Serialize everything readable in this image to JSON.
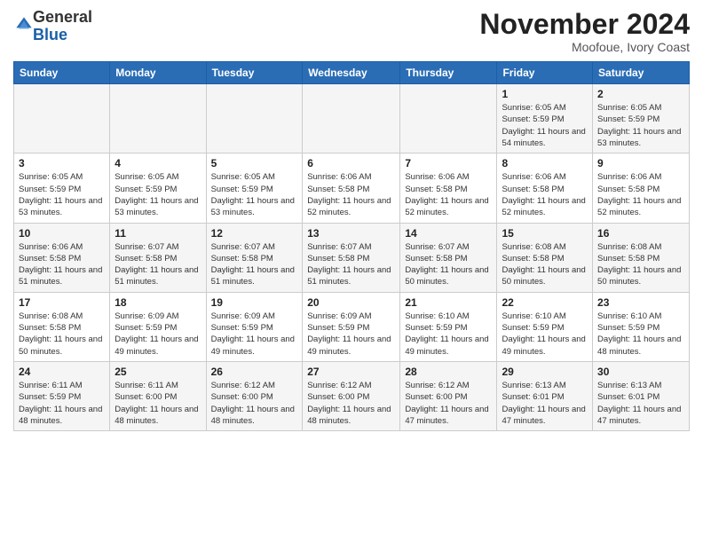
{
  "logo": {
    "general": "General",
    "blue": "Blue"
  },
  "header": {
    "month": "November 2024",
    "location": "Moofoue, Ivory Coast"
  },
  "weekdays": [
    "Sunday",
    "Monday",
    "Tuesday",
    "Wednesday",
    "Thursday",
    "Friday",
    "Saturday"
  ],
  "weeks": [
    [
      {
        "day": "",
        "info": ""
      },
      {
        "day": "",
        "info": ""
      },
      {
        "day": "",
        "info": ""
      },
      {
        "day": "",
        "info": ""
      },
      {
        "day": "",
        "info": ""
      },
      {
        "day": "1",
        "info": "Sunrise: 6:05 AM\nSunset: 5:59 PM\nDaylight: 11 hours and 54 minutes."
      },
      {
        "day": "2",
        "info": "Sunrise: 6:05 AM\nSunset: 5:59 PM\nDaylight: 11 hours and 53 minutes."
      }
    ],
    [
      {
        "day": "3",
        "info": "Sunrise: 6:05 AM\nSunset: 5:59 PM\nDaylight: 11 hours and 53 minutes."
      },
      {
        "day": "4",
        "info": "Sunrise: 6:05 AM\nSunset: 5:59 PM\nDaylight: 11 hours and 53 minutes."
      },
      {
        "day": "5",
        "info": "Sunrise: 6:05 AM\nSunset: 5:59 PM\nDaylight: 11 hours and 53 minutes."
      },
      {
        "day": "6",
        "info": "Sunrise: 6:06 AM\nSunset: 5:58 PM\nDaylight: 11 hours and 52 minutes."
      },
      {
        "day": "7",
        "info": "Sunrise: 6:06 AM\nSunset: 5:58 PM\nDaylight: 11 hours and 52 minutes."
      },
      {
        "day": "8",
        "info": "Sunrise: 6:06 AM\nSunset: 5:58 PM\nDaylight: 11 hours and 52 minutes."
      },
      {
        "day": "9",
        "info": "Sunrise: 6:06 AM\nSunset: 5:58 PM\nDaylight: 11 hours and 52 minutes."
      }
    ],
    [
      {
        "day": "10",
        "info": "Sunrise: 6:06 AM\nSunset: 5:58 PM\nDaylight: 11 hours and 51 minutes."
      },
      {
        "day": "11",
        "info": "Sunrise: 6:07 AM\nSunset: 5:58 PM\nDaylight: 11 hours and 51 minutes."
      },
      {
        "day": "12",
        "info": "Sunrise: 6:07 AM\nSunset: 5:58 PM\nDaylight: 11 hours and 51 minutes."
      },
      {
        "day": "13",
        "info": "Sunrise: 6:07 AM\nSunset: 5:58 PM\nDaylight: 11 hours and 51 minutes."
      },
      {
        "day": "14",
        "info": "Sunrise: 6:07 AM\nSunset: 5:58 PM\nDaylight: 11 hours and 50 minutes."
      },
      {
        "day": "15",
        "info": "Sunrise: 6:08 AM\nSunset: 5:58 PM\nDaylight: 11 hours and 50 minutes."
      },
      {
        "day": "16",
        "info": "Sunrise: 6:08 AM\nSunset: 5:58 PM\nDaylight: 11 hours and 50 minutes."
      }
    ],
    [
      {
        "day": "17",
        "info": "Sunrise: 6:08 AM\nSunset: 5:58 PM\nDaylight: 11 hours and 50 minutes."
      },
      {
        "day": "18",
        "info": "Sunrise: 6:09 AM\nSunset: 5:59 PM\nDaylight: 11 hours and 49 minutes."
      },
      {
        "day": "19",
        "info": "Sunrise: 6:09 AM\nSunset: 5:59 PM\nDaylight: 11 hours and 49 minutes."
      },
      {
        "day": "20",
        "info": "Sunrise: 6:09 AM\nSunset: 5:59 PM\nDaylight: 11 hours and 49 minutes."
      },
      {
        "day": "21",
        "info": "Sunrise: 6:10 AM\nSunset: 5:59 PM\nDaylight: 11 hours and 49 minutes."
      },
      {
        "day": "22",
        "info": "Sunrise: 6:10 AM\nSunset: 5:59 PM\nDaylight: 11 hours and 49 minutes."
      },
      {
        "day": "23",
        "info": "Sunrise: 6:10 AM\nSunset: 5:59 PM\nDaylight: 11 hours and 48 minutes."
      }
    ],
    [
      {
        "day": "24",
        "info": "Sunrise: 6:11 AM\nSunset: 5:59 PM\nDaylight: 11 hours and 48 minutes."
      },
      {
        "day": "25",
        "info": "Sunrise: 6:11 AM\nSunset: 6:00 PM\nDaylight: 11 hours and 48 minutes."
      },
      {
        "day": "26",
        "info": "Sunrise: 6:12 AM\nSunset: 6:00 PM\nDaylight: 11 hours and 48 minutes."
      },
      {
        "day": "27",
        "info": "Sunrise: 6:12 AM\nSunset: 6:00 PM\nDaylight: 11 hours and 48 minutes."
      },
      {
        "day": "28",
        "info": "Sunrise: 6:12 AM\nSunset: 6:00 PM\nDaylight: 11 hours and 47 minutes."
      },
      {
        "day": "29",
        "info": "Sunrise: 6:13 AM\nSunset: 6:01 PM\nDaylight: 11 hours and 47 minutes."
      },
      {
        "day": "30",
        "info": "Sunrise: 6:13 AM\nSunset: 6:01 PM\nDaylight: 11 hours and 47 minutes."
      }
    ]
  ]
}
